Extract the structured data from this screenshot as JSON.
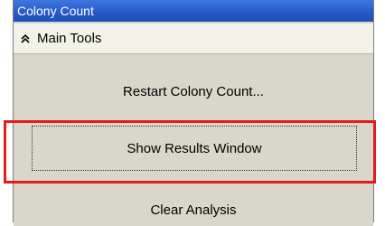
{
  "window": {
    "title": "Colony Count"
  },
  "section": {
    "title": "Main Tools",
    "icon": "double-chevron-up-icon"
  },
  "buttons": {
    "restart": "Restart Colony Count...",
    "show_results": "Show Results Window",
    "clear": "Clear Analysis"
  },
  "colors": {
    "titlebar": "#2558c7",
    "panel": "#d9d7cc",
    "highlight": "#e61b1b"
  }
}
